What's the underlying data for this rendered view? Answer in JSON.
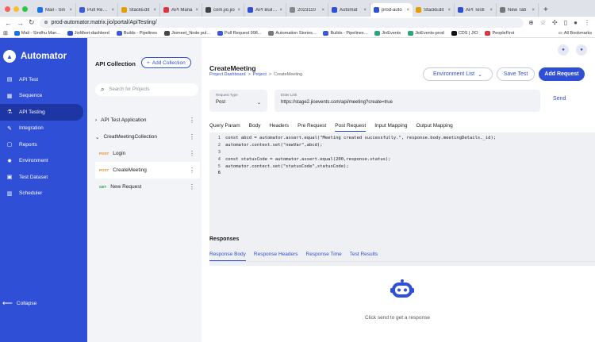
{
  "browser": {
    "tabs": [
      {
        "label": "Mail - Sin",
        "color": "#1a73e8"
      },
      {
        "label": "Pull Reque",
        "color": "#3b5bdb"
      },
      {
        "label": "StackEdit",
        "color": "#e0a100"
      },
      {
        "label": "API Mana",
        "color": "#d9363e"
      },
      {
        "label": "com.jio.jio",
        "color": "#444444"
      },
      {
        "label": "API Builde",
        "color": "#2f4fd6"
      },
      {
        "label": "2023110",
        "color": "#888888"
      },
      {
        "label": "Automat",
        "color": "#2f4fd6"
      },
      {
        "label": "prod-auto",
        "color": "#2f4fd6"
      },
      {
        "label": "StackEdit",
        "color": "#e0a100"
      },
      {
        "label": "API Testi",
        "color": "#2f4fd6"
      },
      {
        "label": "New Tab",
        "color": "#777777"
      }
    ],
    "url": "prod-automator.matrix.jio/portal/ApiTesting/",
    "bookmarks": [
      {
        "label": "Mail - Sindhu Man...",
        "color": "#1a73e8"
      },
      {
        "label": "JioMeet-dashbord",
        "color": "#2f4fd6"
      },
      {
        "label": "Builds - Pipelines",
        "color": "#3b5bdb"
      },
      {
        "label": "Jiomeet_Node pul...",
        "color": "#444444"
      },
      {
        "label": "Pull Request 998...",
        "color": "#3b5bdb"
      },
      {
        "label": "Automation Stories...",
        "color": "#777777"
      },
      {
        "label": "Builds - Pipelines...",
        "color": "#3b5bdb"
      },
      {
        "label": "JioEvents",
        "color": "#2aa57a"
      },
      {
        "label": "JioEvents-prod",
        "color": "#2aa57a"
      },
      {
        "label": "CDS | JIO",
        "color": "#111111"
      },
      {
        "label": "PeopleFirst",
        "color": "#d9363e"
      }
    ],
    "all_bookmarks": "All Bookmarks"
  },
  "app": {
    "name": "Automator",
    "nav": [
      {
        "label": "API Test",
        "icon": "document-icon"
      },
      {
        "label": "Sequence",
        "icon": "sequence-icon"
      },
      {
        "label": "API Testing",
        "icon": "flask-icon",
        "active": true
      },
      {
        "label": "Integration",
        "icon": "wrench-icon"
      },
      {
        "label": "Reports",
        "icon": "file-icon"
      },
      {
        "label": "Environment",
        "icon": "gear-icon"
      },
      {
        "label": "Test Dataset",
        "icon": "database-icon"
      },
      {
        "label": "Scheduler",
        "icon": "bars-icon"
      }
    ],
    "collapse": "Collapse"
  },
  "collections": {
    "title": "API Collection",
    "add_label": "Add Collection",
    "search_placeholder": "Search for Projects",
    "tree": [
      {
        "label": "API Test Application",
        "kind": "folder",
        "expanded": false
      },
      {
        "label": "CreatMeetingCollection",
        "kind": "folder",
        "expanded": true
      },
      {
        "label": "Login",
        "kind": "request",
        "method": "POST"
      },
      {
        "label": "CreateMeeting",
        "kind": "request",
        "method": "POST",
        "selected": true
      },
      {
        "label": "New Request",
        "kind": "request",
        "method": "GET"
      }
    ]
  },
  "main": {
    "title": "CreateMeeting",
    "breadcrumb": [
      "Project Dashboard",
      "Project",
      "CreateMeeting"
    ],
    "env_label": "Environment List",
    "save_label": "Save Test",
    "add_request_label": "Add Request",
    "request_type_label": "Request Type",
    "request_type_value": "Post",
    "link_label": "Enter Link",
    "link_value": "https://stage2.jioevents.com/api/meeting?create=true",
    "send_label": "Send",
    "tabs": [
      "Query Param",
      "Body",
      "Headers",
      "Pre Request",
      "Post Request",
      "Input Mapping",
      "Output Mapping"
    ],
    "active_tab": "Post Request",
    "code_lines": [
      "const abcd = automator.assert.equal(\"Meeting created successfully.\", response.body.meetingDetails._id);",
      "automator.context.set(\"newVar\",abcd);",
      "",
      "const statusCode = automator.assert.equal(200,response.status);",
      "automator.contect.set(\"statusCode\",statusCode);",
      ""
    ],
    "responses_title": "Responses",
    "response_tabs": [
      "Response Body",
      "Response Headers",
      "Response Time",
      "Test Results"
    ],
    "empty_hint": "Click send to get a response"
  }
}
